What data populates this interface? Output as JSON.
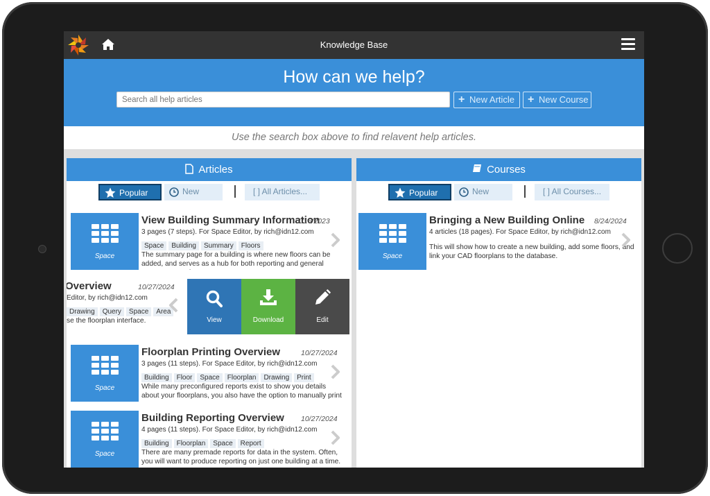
{
  "app": {
    "title": "Knowledge Base"
  },
  "hero": {
    "title": "How can we help?",
    "search_placeholder": "Search all help articles",
    "new_article": "New Article",
    "new_course": "New Course",
    "hint": "Use the search box above to find relavent help articles."
  },
  "articles": {
    "header": "Articles",
    "tabs": {
      "popular": "Popular",
      "new": "New",
      "all": "[ ]  All Articles..."
    },
    "items": [
      {
        "title": "View Building Summary Information",
        "date": "1/16/2023",
        "meta": "3 pages (7 steps). For Space Editor, by rich@idn12.com",
        "tags": [
          "Space",
          "Building",
          "Summary",
          "Floors"
        ],
        "desc": "The summary page for a building is where new floors can be added, and serves as a hub for both reporting and general management of",
        "category": "Space"
      },
      {
        "title": "Overview",
        "date": "10/27/2024",
        "meta": "Editor, by rich@idn12.com",
        "tags": [
          "Drawing",
          "Query",
          "Space",
          "Area"
        ],
        "desc": "se the floorplan interface.",
        "category": "Space"
      },
      {
        "title": "Floorplan Printing Overview",
        "date": "10/27/2024",
        "meta": "3 pages (11 steps). For Space Editor, by rich@idn12.com",
        "tags": [
          "Building",
          "Floor",
          "Space",
          "Floorplan",
          "Drawing",
          "Print"
        ],
        "desc": "While many preconfigured reports exist to show you details about your floorplans, you also have the option to manually print at any",
        "category": "Space"
      },
      {
        "title": "Building Reporting Overview",
        "date": "10/27/2024",
        "meta": "4 pages (11 steps). For Space Editor, by rich@idn12.com",
        "tags": [
          "Building",
          "Floorplan",
          "Space",
          "Report"
        ],
        "desc": "There are many premade reports for data in the system. Often, you will want to produce reporting on just one building at a time.",
        "category": "Space"
      }
    ],
    "actions": {
      "view": "View",
      "download": "Download",
      "edit": "Edit"
    }
  },
  "courses": {
    "header": "Courses",
    "tabs": {
      "popular": "Popular",
      "new": "New",
      "all": "[ ]  All Courses..."
    },
    "items": [
      {
        "title": "Bringing a New Building Online",
        "date": "8/24/2024",
        "meta": "4 articles (18 pages). For Space Editor, by rich@idn12.com",
        "desc": "This will show how to create a new building, add some floors, and link your CAD floorplans to the database.",
        "category": "Space"
      }
    ]
  },
  "colors": {
    "accent": "#3a8fd9",
    "topbar": "#333333",
    "view": "#2f75b5",
    "download": "#5cb343",
    "edit": "#4a4a4a"
  }
}
